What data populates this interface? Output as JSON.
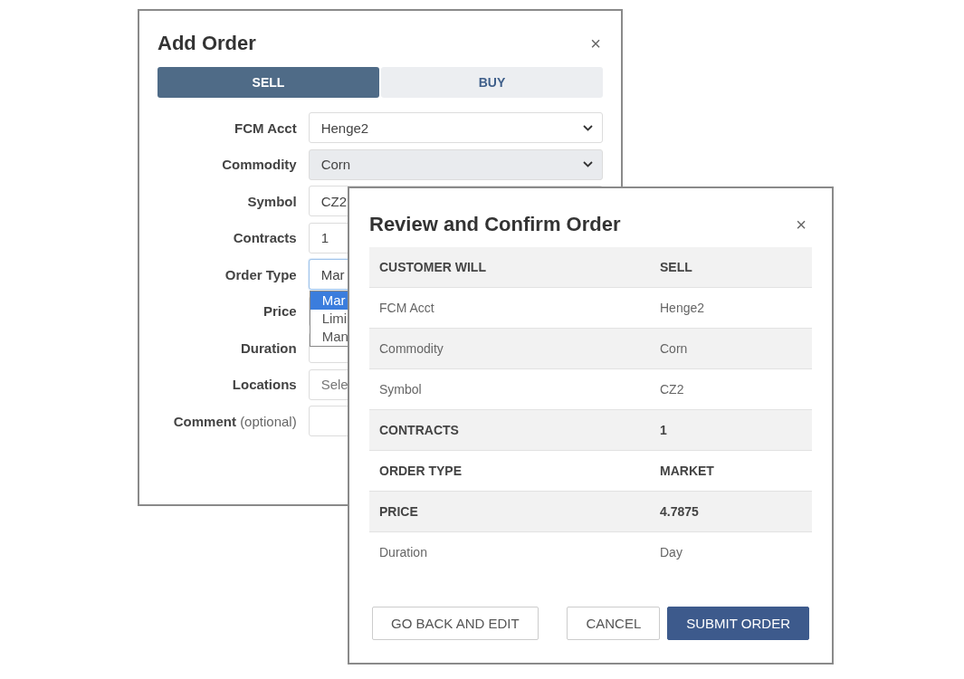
{
  "add_order": {
    "title": "Add Order",
    "close": "×",
    "tabs": [
      {
        "label": "SELL",
        "selected": true
      },
      {
        "label": "BUY",
        "selected": false
      }
    ],
    "fields": [
      {
        "label": "FCM Acct",
        "kind": "select",
        "value": "Henge2",
        "disabled": false,
        "focused": false
      },
      {
        "label": "Commodity",
        "kind": "select",
        "value": "Corn",
        "disabled": true,
        "focused": false
      },
      {
        "label": "Symbol",
        "kind": "input",
        "value": "CZ2",
        "disabled": false,
        "focused": false
      },
      {
        "label": "Contracts",
        "kind": "input",
        "value": "1",
        "disabled": false,
        "focused": false
      },
      {
        "label": "Order Type",
        "kind": "input",
        "value": "Mar",
        "disabled": false,
        "focused": true,
        "options": [
          {
            "label": "Mar",
            "selected": true
          },
          {
            "label": "Limi",
            "selected": false
          },
          {
            "label": "Man",
            "selected": false
          }
        ]
      },
      {
        "label": "Price",
        "kind": "input"
      },
      {
        "label": "Duration",
        "kind": "input",
        "disabled": false,
        "focused": false
      },
      {
        "label": "Locations",
        "kind": "input",
        "placeholder": "Sele",
        "disabled": false,
        "focused": false
      },
      {
        "label": "Comment",
        "hint": "(optional)",
        "kind": "input",
        "disabled": false,
        "focused": false
      }
    ]
  },
  "review": {
    "title": "Review and Confirm Order",
    "close": "×",
    "rows": [
      {
        "label": "CUSTOMER WILL",
        "value": "SELL",
        "emphasized": true
      },
      {
        "label": "FCM Acct",
        "value": "Henge2",
        "emphasized": false
      },
      {
        "label": "Commodity",
        "value": "Corn",
        "emphasized": false
      },
      {
        "label": "Symbol",
        "value": "CZ2",
        "emphasized": false
      },
      {
        "label": "CONTRACTS",
        "value": "1",
        "emphasized": true
      },
      {
        "label": "ORDER TYPE",
        "value": "MARKET",
        "emphasized": true
      },
      {
        "label": "PRICE",
        "value": "4.7875",
        "emphasized": true
      },
      {
        "label": "Duration",
        "value": "Day",
        "emphasized": false
      }
    ],
    "buttons": [
      {
        "label": "GO BACK AND EDIT",
        "kind": "secondary"
      },
      {
        "label": "CANCEL",
        "kind": "secondary"
      },
      {
        "label": "SUBMIT ORDER",
        "kind": "primary"
      }
    ]
  }
}
